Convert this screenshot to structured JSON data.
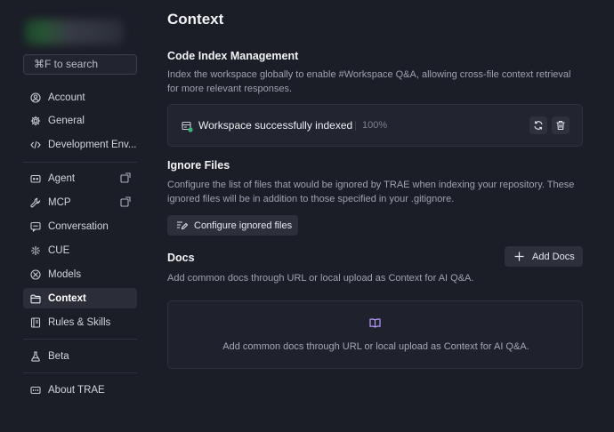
{
  "sidebar": {
    "search_label": "⌘F to search",
    "items": [
      {
        "label": "Account",
        "icon": "account-icon"
      },
      {
        "label": "General",
        "icon": "gear-icon"
      },
      {
        "label": "Development Env...",
        "icon": "code-icon"
      },
      {
        "label": "Agent",
        "icon": "agent-icon",
        "external": true
      },
      {
        "label": "MCP",
        "icon": "wrench-icon",
        "external": true
      },
      {
        "label": "Conversation",
        "icon": "chat-icon"
      },
      {
        "label": "CUE",
        "icon": "cue-icon"
      },
      {
        "label": "Models",
        "icon": "models-icon"
      },
      {
        "label": "Context",
        "icon": "folder-icon",
        "active": true
      },
      {
        "label": "Rules & Skills",
        "icon": "book-icon"
      },
      {
        "label": "Beta",
        "icon": "flask-icon"
      },
      {
        "label": "About TRAE",
        "icon": "about-icon"
      }
    ]
  },
  "main": {
    "title": "Context",
    "code_index": {
      "title": "Code Index Management",
      "description": "Index the workspace globally to enable #Workspace Q&A, allowing cross-file context retrieval for more relevant responses.",
      "status_text": "Workspace successfully indexed",
      "progress_text": "100%",
      "progress": 1.0
    },
    "ignore_files": {
      "title": "Ignore Files",
      "description": "Configure the list of files that would be ignored by TRAE when indexing your repository. These ignored files will be in addition to those specified in your .gitignore.",
      "button_label": "Configure ignored files"
    },
    "docs": {
      "title": "Docs",
      "add_button_label": "Add Docs",
      "description": "Add common docs through URL or local upload as Context for AI Q&A.",
      "empty_text": "Add common docs through URL or local upload as Context for AI Q&A."
    }
  },
  "colors": {
    "background": "#1b1d27",
    "card": "#222530",
    "success": "#3fb27f",
    "accent_book": "#b89cff"
  }
}
